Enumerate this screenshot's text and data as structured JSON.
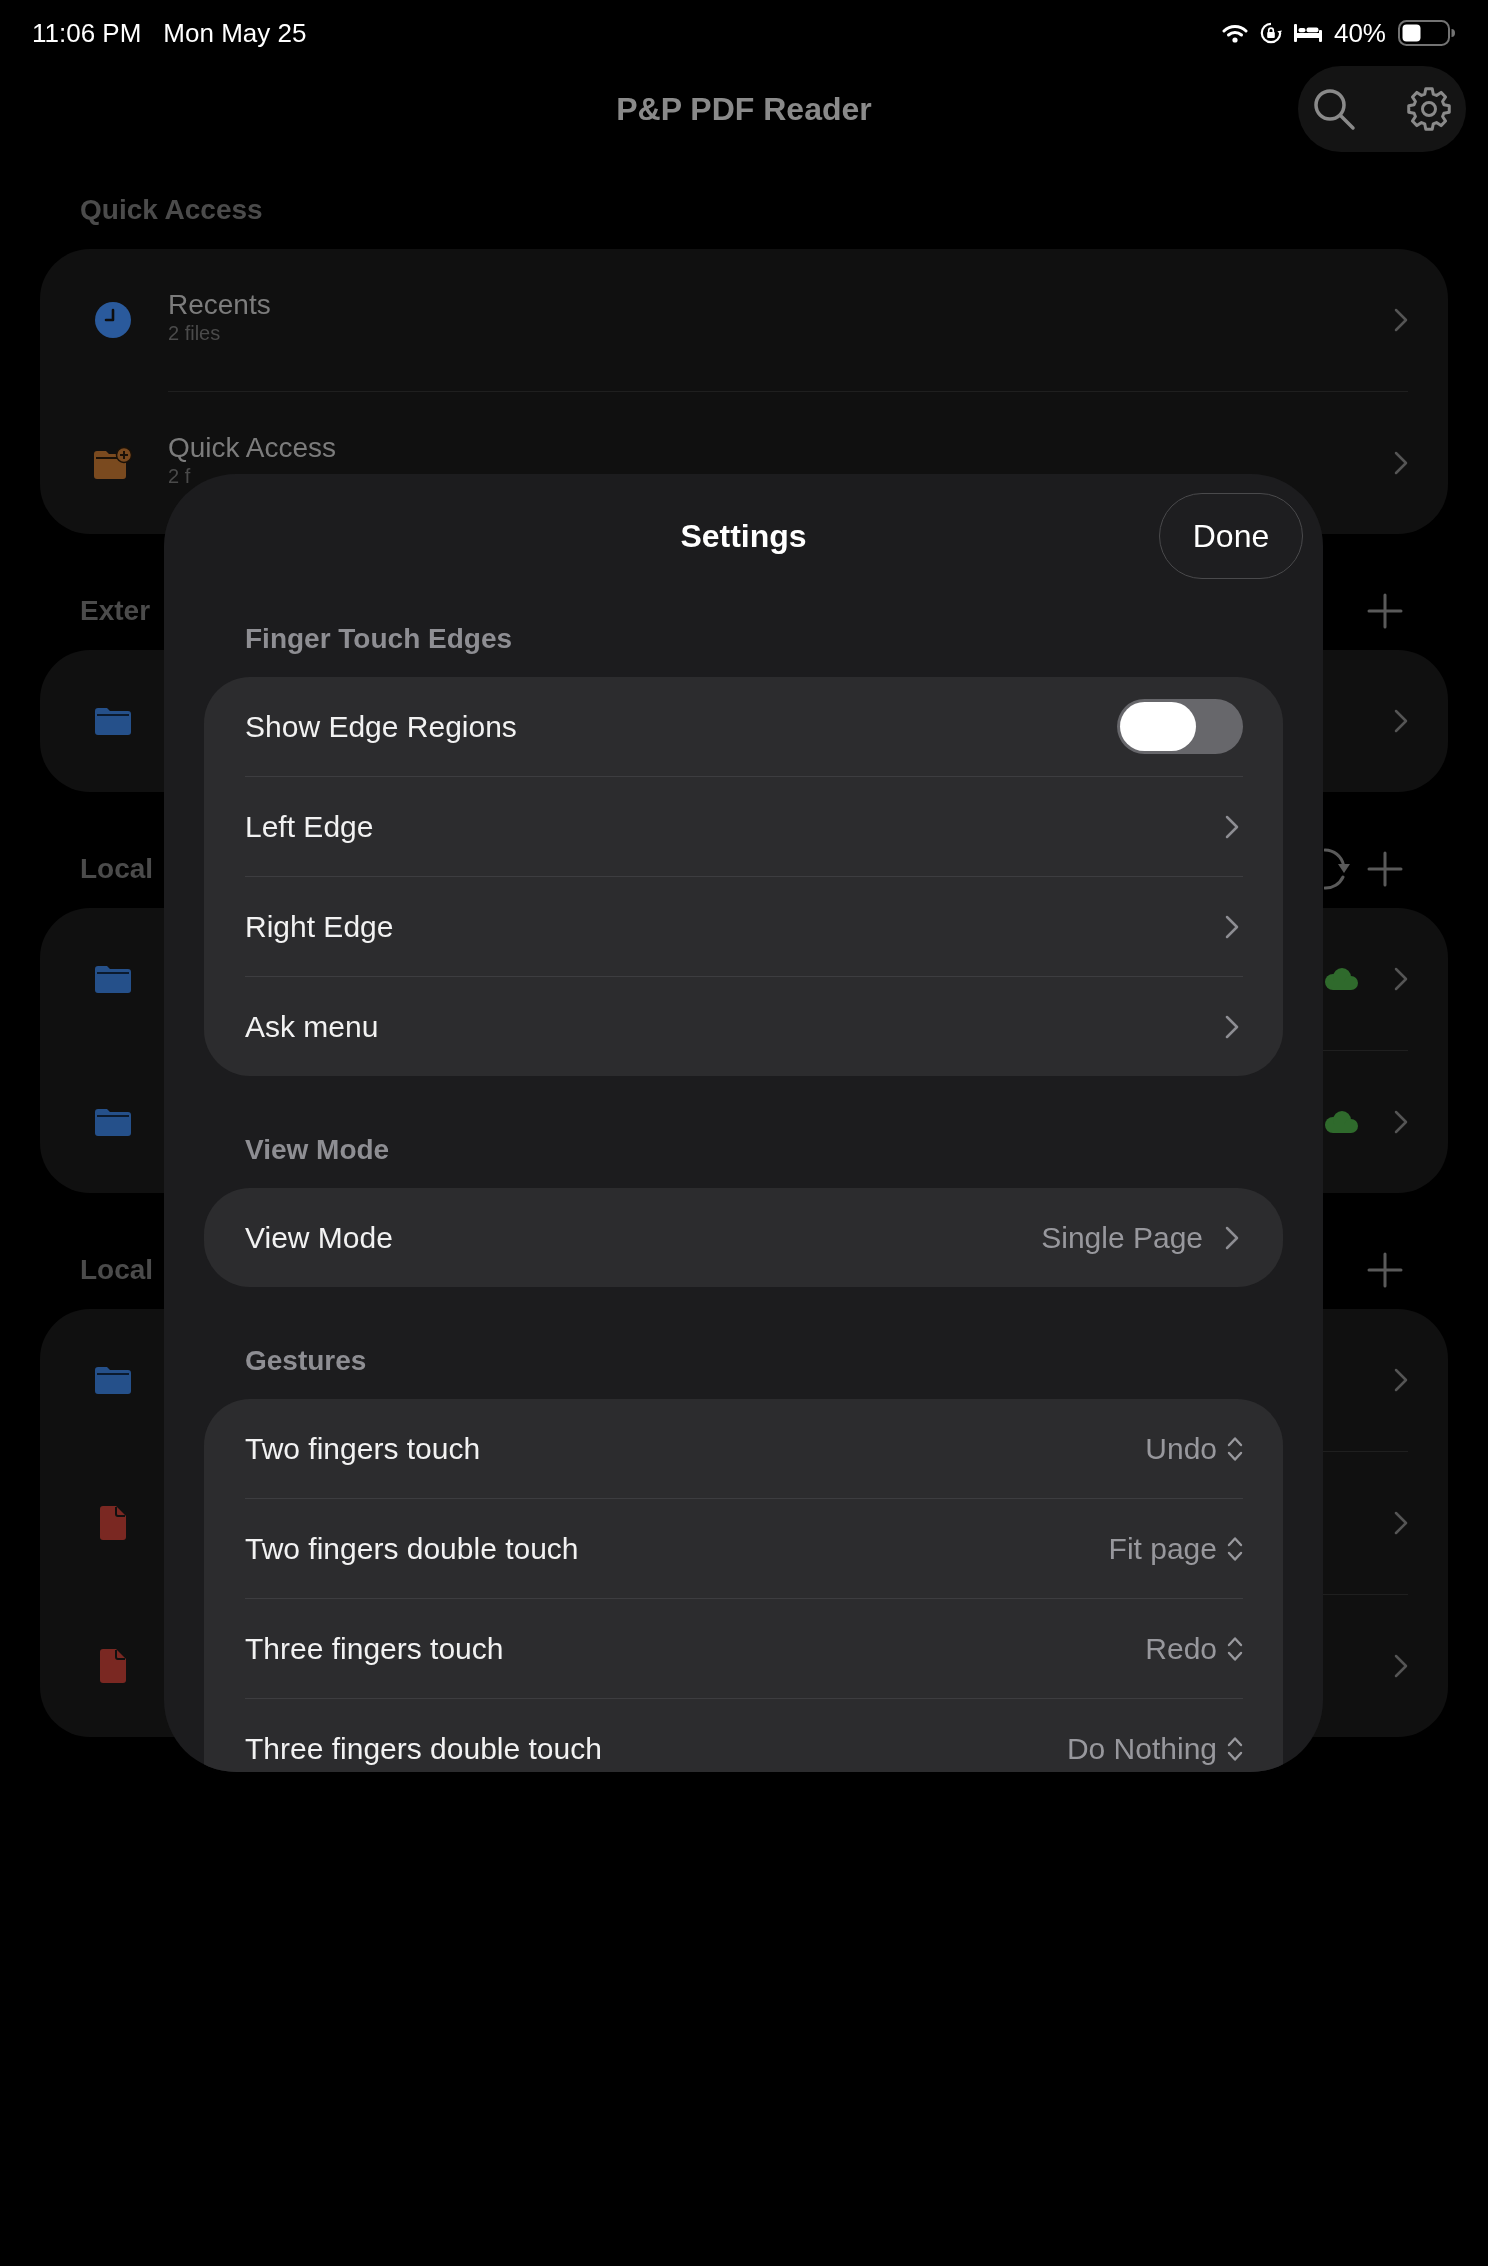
{
  "status_bar": {
    "time": "11:06 PM",
    "date": "Mon May 25",
    "battery": "40%"
  },
  "navigation_bar": {
    "title": "P&P PDF Reader"
  },
  "sections": [
    {
      "header": "Quick Access",
      "rows": [
        {
          "kind": "clock",
          "title": "Recents",
          "subtitle": "2 files"
        },
        {
          "kind": "folder_plus",
          "title": "Quick Access",
          "subtitle": "2 f"
        }
      ]
    },
    {
      "header": "Exter",
      "add_button": true,
      "rows": [
        {
          "kind": "folder"
        }
      ]
    },
    {
      "header": "Local",
      "add_button": true,
      "refresh_button": true,
      "rows": [
        {
          "kind": "folder",
          "synced": true
        },
        {
          "kind": "folder",
          "synced": true
        }
      ]
    },
    {
      "header": "Local",
      "add_button": true,
      "rows": [
        {
          "kind": "folder"
        },
        {
          "kind": "document"
        },
        {
          "kind": "document"
        }
      ]
    }
  ],
  "settings_sheet": {
    "title": "Settings",
    "done_button": "Done",
    "sections": [
      {
        "header": "Finger Touch Edges",
        "rows": [
          {
            "kind": "toggle",
            "label": "Show Edge Regions",
            "on": false
          },
          {
            "kind": "link",
            "label": "Left Edge"
          },
          {
            "kind": "link",
            "label": "Right Edge"
          },
          {
            "kind": "link",
            "label": "Ask menu"
          }
        ]
      },
      {
        "header": "View Mode",
        "rows": [
          {
            "kind": "link",
            "label": "View Mode",
            "value": "Single Page"
          }
        ]
      },
      {
        "header": "Gestures",
        "rows": [
          {
            "kind": "picker",
            "label": "Two fingers touch",
            "value": "Undo"
          },
          {
            "kind": "picker",
            "label": "Two fingers double touch",
            "value": "Fit page"
          },
          {
            "kind": "picker",
            "label": "Three fingers touch",
            "value": "Redo"
          },
          {
            "kind": "picker",
            "label": "Three fingers double touch",
            "value": "Do Nothing"
          }
        ]
      }
    ]
  }
}
